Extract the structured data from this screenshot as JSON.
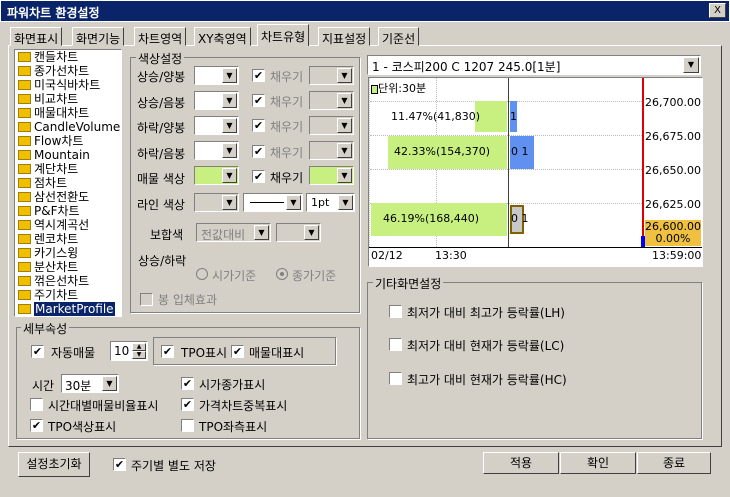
{
  "window": {
    "title": "파워차트 환경설정",
    "close_label": "X"
  },
  "tabs": [
    "화면표시",
    "화면기능",
    "차트영역",
    "XY축영역",
    "차트유형",
    "지표설정",
    "기준선"
  ],
  "chart_types": [
    "캔들차트",
    "종가선차트",
    "미국식바차트",
    "비교차트",
    "매물대차트",
    "CandleVolume",
    "Flow차트",
    "Mountain",
    "계단차트",
    "점차트",
    "삼선전환도",
    "P&F차트",
    "역시계곡선",
    "렌코차트",
    "카기스윙",
    "분산차트",
    "꺾은선차트",
    "주기차트",
    "MarketProfile"
  ],
  "color_settings": {
    "title": "색상설정",
    "rows": [
      {
        "label": "상승/양봉",
        "fill_label": "채우기",
        "fill_checked": true
      },
      {
        "label": "상승/음봉",
        "fill_label": "채우기",
        "fill_checked": true
      },
      {
        "label": "하락/양봉",
        "fill_label": "채우기",
        "fill_checked": true
      },
      {
        "label": "하락/음봉",
        "fill_label": "채우기",
        "fill_checked": true
      },
      {
        "label": "매물 색상",
        "fill_label": "채우기",
        "fill_checked": true
      }
    ],
    "line_color_label": "라인 색상",
    "line_width": "1pt",
    "complement_label": "보합색",
    "complement_value": "전값대비",
    "updown_label": "상승/하락",
    "radio_open": "시가기준",
    "radio_close": "종가기준",
    "stereo_label": "봉 입체효과",
    "accent": "#c8f080"
  },
  "preview": {
    "selector": "1 - 코스피200 C 1207 245.0[1분]",
    "unit": "단위:30분",
    "labels": [
      "11.47%(41,830)",
      "42.33%(154,370)",
      "46.19%(168,440)"
    ],
    "bar_labels": [
      "1",
      "0 1",
      "0 1"
    ],
    "prices": [
      "26,700.00",
      "26,675.00",
      "26,650.00",
      "26,625.00"
    ],
    "current_price": "26,600.00",
    "current_pct": "0.00%",
    "x_axis": [
      "02/12",
      "13:30",
      "13:59:00"
    ]
  },
  "sub_attrs": {
    "title": "세부속성",
    "auto_volume": "자동매물",
    "auto_volume_value": "10",
    "tpo_show": "TPO표시",
    "volume_show": "매물대표시",
    "time_label": "시간",
    "time_value": "30분",
    "open_close_show": "시가종가표시",
    "time_volume_ratio": "시간대별매물비율표시",
    "price_chart_overlay": "가격차트중복표시",
    "tpo_color": "TPO색상표시",
    "tpo_left": "TPO좌측표시"
  },
  "other_settings": {
    "title": "기타화면설정",
    "items": [
      "최저가 대비 최고가 등락률(LH)",
      "최저가 대비 현재가 등락률(LC)",
      "최고가 대비 현재가 등락률(HC)"
    ]
  },
  "footer": {
    "reset": "설정초기화",
    "save_per_period": "주기별 별도 저장",
    "apply": "적용",
    "ok": "확인",
    "close": "종료"
  }
}
